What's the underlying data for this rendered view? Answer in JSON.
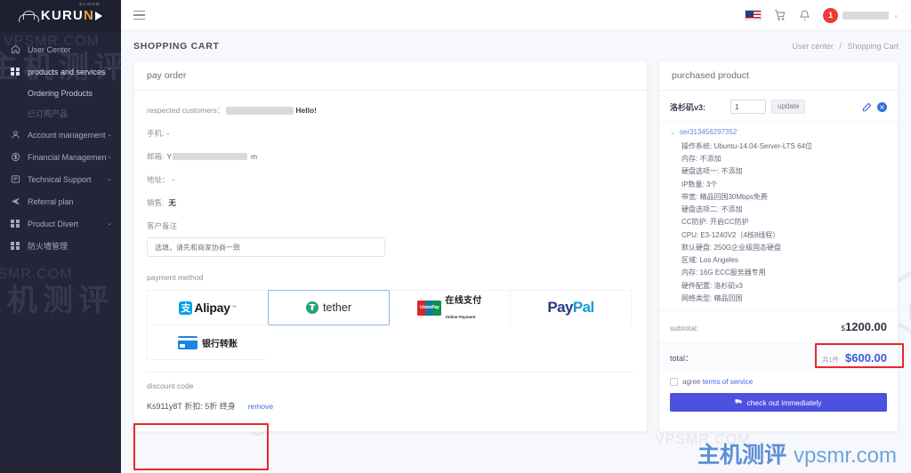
{
  "brand": {
    "logo_text_1": "KURU",
    "logo_text_accent": "N",
    "logo_sub": "CLOUD"
  },
  "sidebar": {
    "items": [
      {
        "label": "User Center",
        "icon": "home-icon",
        "caret": "",
        "type": "item"
      },
      {
        "label": "products and services",
        "icon": "grid-icon",
        "caret": "⌃",
        "type": "item"
      },
      {
        "label": "Ordering Products",
        "icon": "",
        "caret": "",
        "type": "sub"
      },
      {
        "label": "已订购产品",
        "icon": "",
        "caret": "",
        "type": "sub-dim"
      },
      {
        "label": "Account management",
        "icon": "user-icon",
        "caret": "⌄",
        "type": "item"
      },
      {
        "label": "Financial Management",
        "icon": "dollar-circle-icon",
        "caret": "⌄",
        "type": "item"
      },
      {
        "label": "Technical Support",
        "icon": "ticket-icon",
        "caret": "⌄",
        "type": "item"
      },
      {
        "label": "Referral plan",
        "icon": "send-icon",
        "caret": "",
        "type": "item"
      },
      {
        "label": "Product Divert",
        "icon": "grid-icon",
        "caret": "⌄",
        "type": "item"
      },
      {
        "label": "防火墙管理",
        "icon": "grid-icon",
        "caret": "",
        "type": "item"
      }
    ]
  },
  "topbar": {
    "menu_icon": "hamburger-icon",
    "flag": "us-flag-icon",
    "cart_icon": "cart-icon",
    "bell_icon": "bell-icon",
    "notification_count": "1",
    "user_name": "",
    "chevron": "⌄"
  },
  "page": {
    "title": "SHOPPING CART",
    "breadcrumb": {
      "parent": "User center",
      "separator": "/",
      "current": "Shopping Cart"
    }
  },
  "pay_order": {
    "card_title": "pay order",
    "customer_label": "respected customers：",
    "customer_name": "",
    "customer_greeting": "Hello!",
    "phone_label": "手机:",
    "phone_value": "-",
    "email_label": "邮箱:",
    "email_value_prefix": "Y",
    "email_value_suffix": "m",
    "address_label": "地址：",
    "address_value": "-",
    "sales_label": "销售:",
    "sales_value": "无",
    "remark_label": "客户备注",
    "remark_placeholder": "选填，请先和商家协商一致",
    "remark_value": ""
  },
  "payment": {
    "label": "payment method",
    "methods": [
      {
        "name": "Alipay",
        "id": "alipay",
        "selected": false
      },
      {
        "name": "tether",
        "id": "tether",
        "selected": true
      },
      {
        "name": "在线支付",
        "subname": "Online Payment",
        "id": "unionpay",
        "selected": false
      },
      {
        "name": "PayPal",
        "id": "paypal",
        "selected": false
      },
      {
        "name": "银行转账",
        "id": "bank-transfer",
        "selected": false
      }
    ]
  },
  "discount": {
    "title": "discount code",
    "code_text": "Ks911y8T 折扣: 5折 终身",
    "remove_label": "remove"
  },
  "purchased": {
    "card_title": "purchased product",
    "product_name": "洛杉矶v3:",
    "quantity": "1",
    "update_label": "update",
    "edit_icon": "pencil-icon",
    "delete_icon": "delete-circle-icon",
    "service_id": "ser313456297352",
    "specs": [
      "操作系统: Ubuntu-14.04-Server-LTS 64位",
      "内存: 不添加",
      "硬盘选项一: 不添加",
      "IP数量: 3个",
      "带宽: 精品回国30Mbps免费",
      "硬盘选项二: 不添加",
      "CC防护: 开启CC防护",
      "CPU: E3-1240V2（4核8线程）",
      "默认硬盘: 250G企业级固态硬盘",
      "区域: Los Angeles",
      "内存: 16G ECC服务器专用",
      "硬件配置: 洛杉矶v3",
      "网络类型: 精品回国"
    ],
    "subtotal_label": "subtotal:",
    "subtotal_currency": "$",
    "subtotal_value": "1200.00",
    "total_label": "total：",
    "total_count": "共1件",
    "total_value": "$600.00",
    "agree_prefix": "agree",
    "terms_label": "terms of service",
    "checkout_label": "check out immediately",
    "checkout_icon": "truck-icon"
  },
  "colors": {
    "sidebar_bg": "#242539",
    "accent_blue": "#4d51e0",
    "total_blue": "#3b5bdb",
    "highlight_red": "#e8262d",
    "badge_red": "#ee3a3a"
  },
  "watermarks": {
    "cn": "主机测评",
    "en": "VPSMR.COM",
    "footer_cn": "主机测评",
    "footer_en": "vpsmr.com"
  }
}
